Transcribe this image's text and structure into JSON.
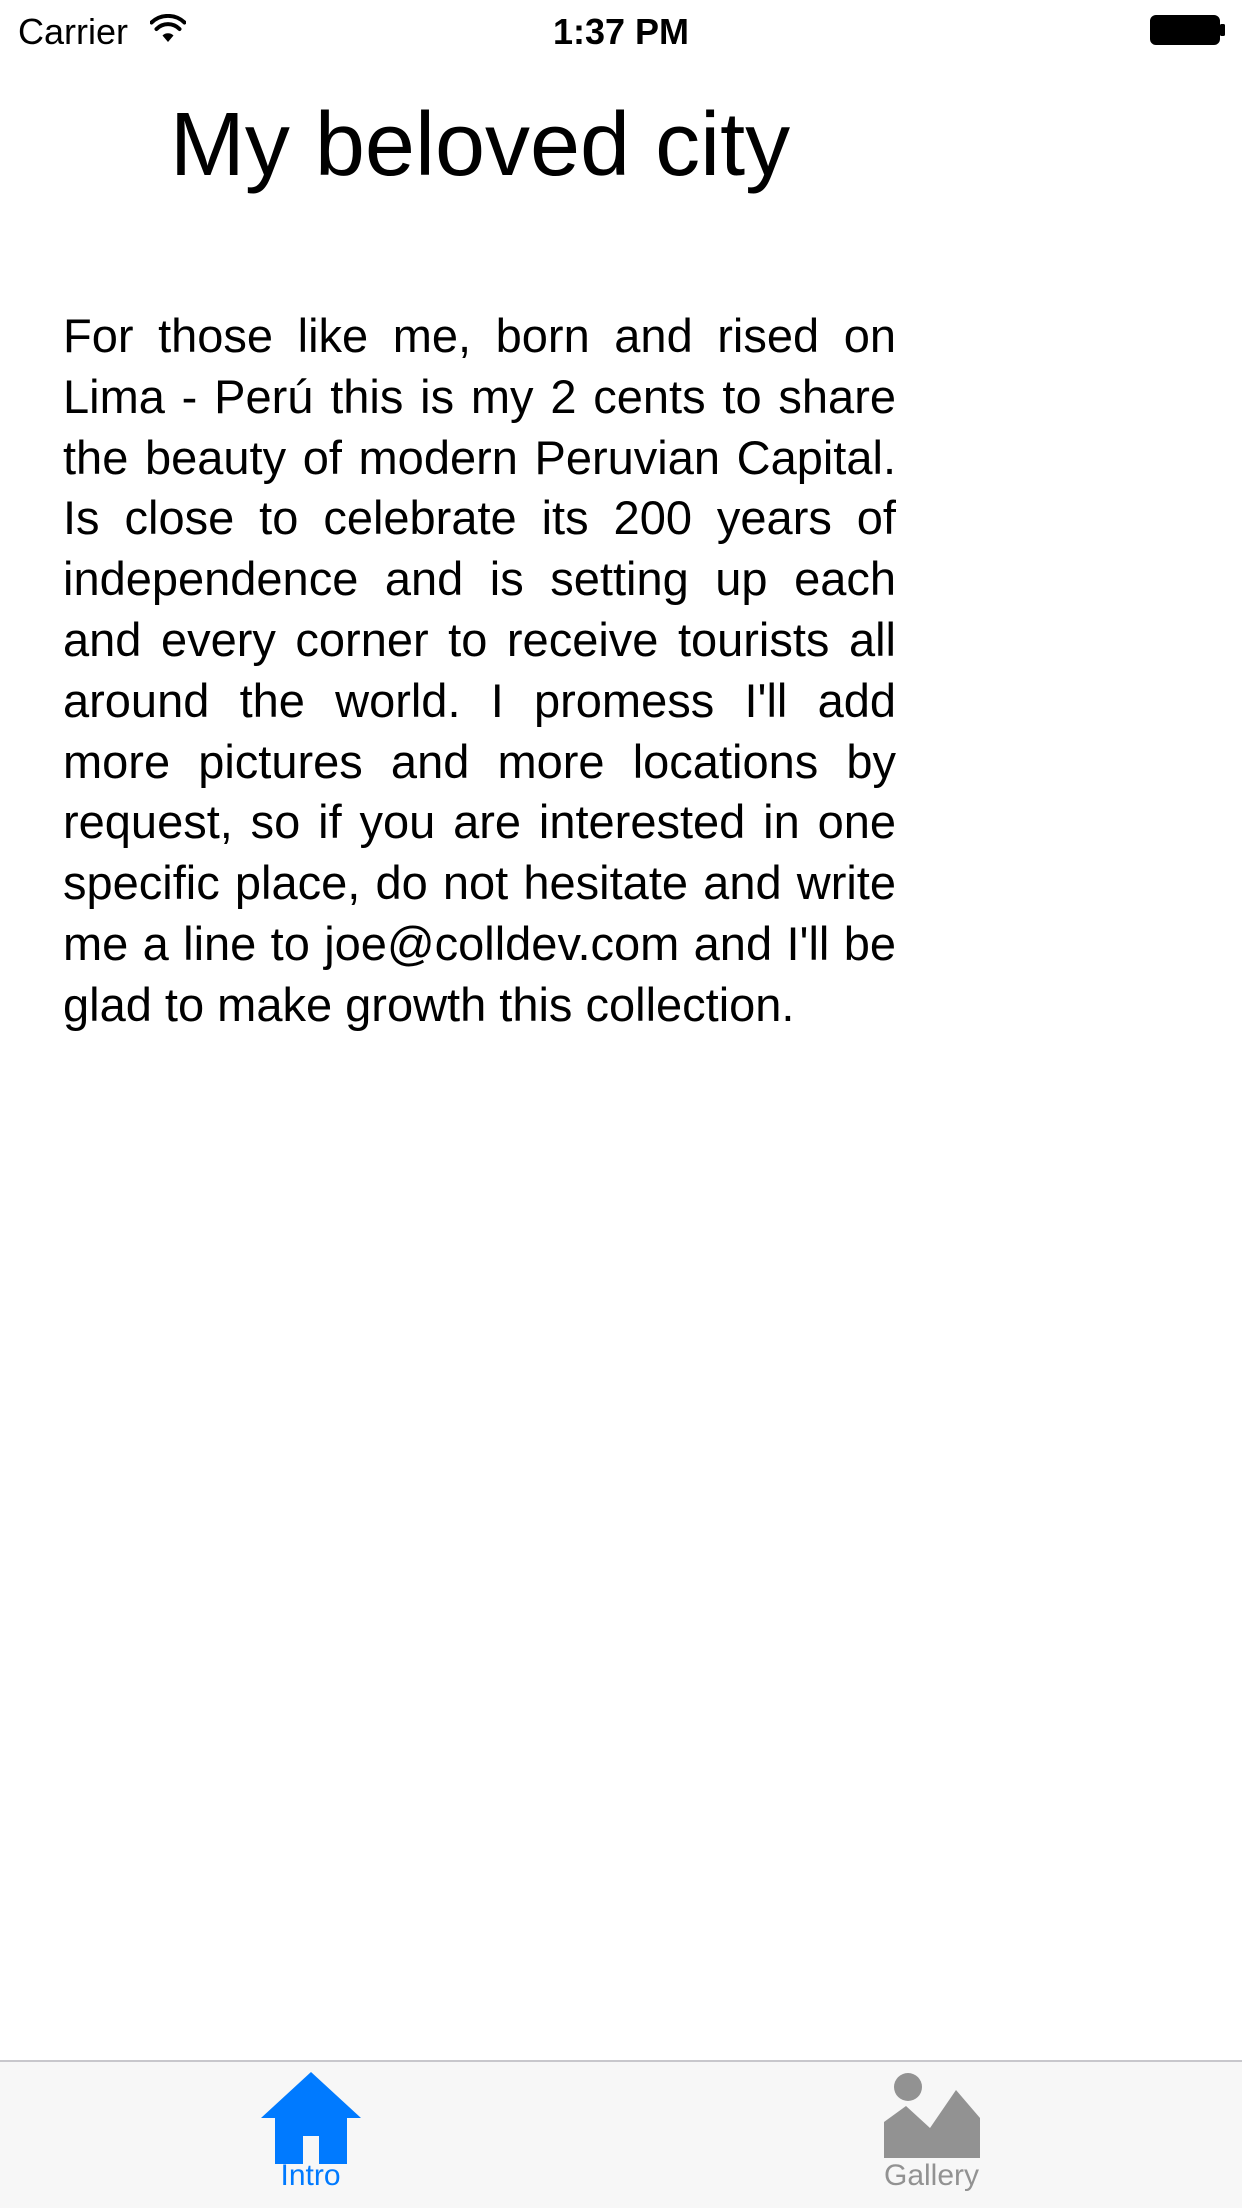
{
  "status_bar": {
    "carrier": "Carrier",
    "time": "1:37 PM"
  },
  "page": {
    "title": "My beloved city",
    "body": "For those like me, born and rised on Lima - Perú this is my 2 cents to share the beauty of modern Peruvian Capital. Is close to celebrate its 200 years of independence and is setting up each and every corner to receive tourists all around the world. I promess I'll add more pictures and more locations by request, so if you are interested in one specific place, do not hesitate and write me a line to joe@colldev.com and I'll be glad to make growth this collection."
  },
  "tab_bar": {
    "tabs": [
      {
        "label": "Intro",
        "icon": "home-icon",
        "selected": true
      },
      {
        "label": "Gallery",
        "icon": "gallery-icon",
        "selected": false
      }
    ]
  },
  "colors": {
    "accent": "#007aff",
    "inactive": "#929292",
    "tab_bar_bg": "#f7f7f7"
  }
}
